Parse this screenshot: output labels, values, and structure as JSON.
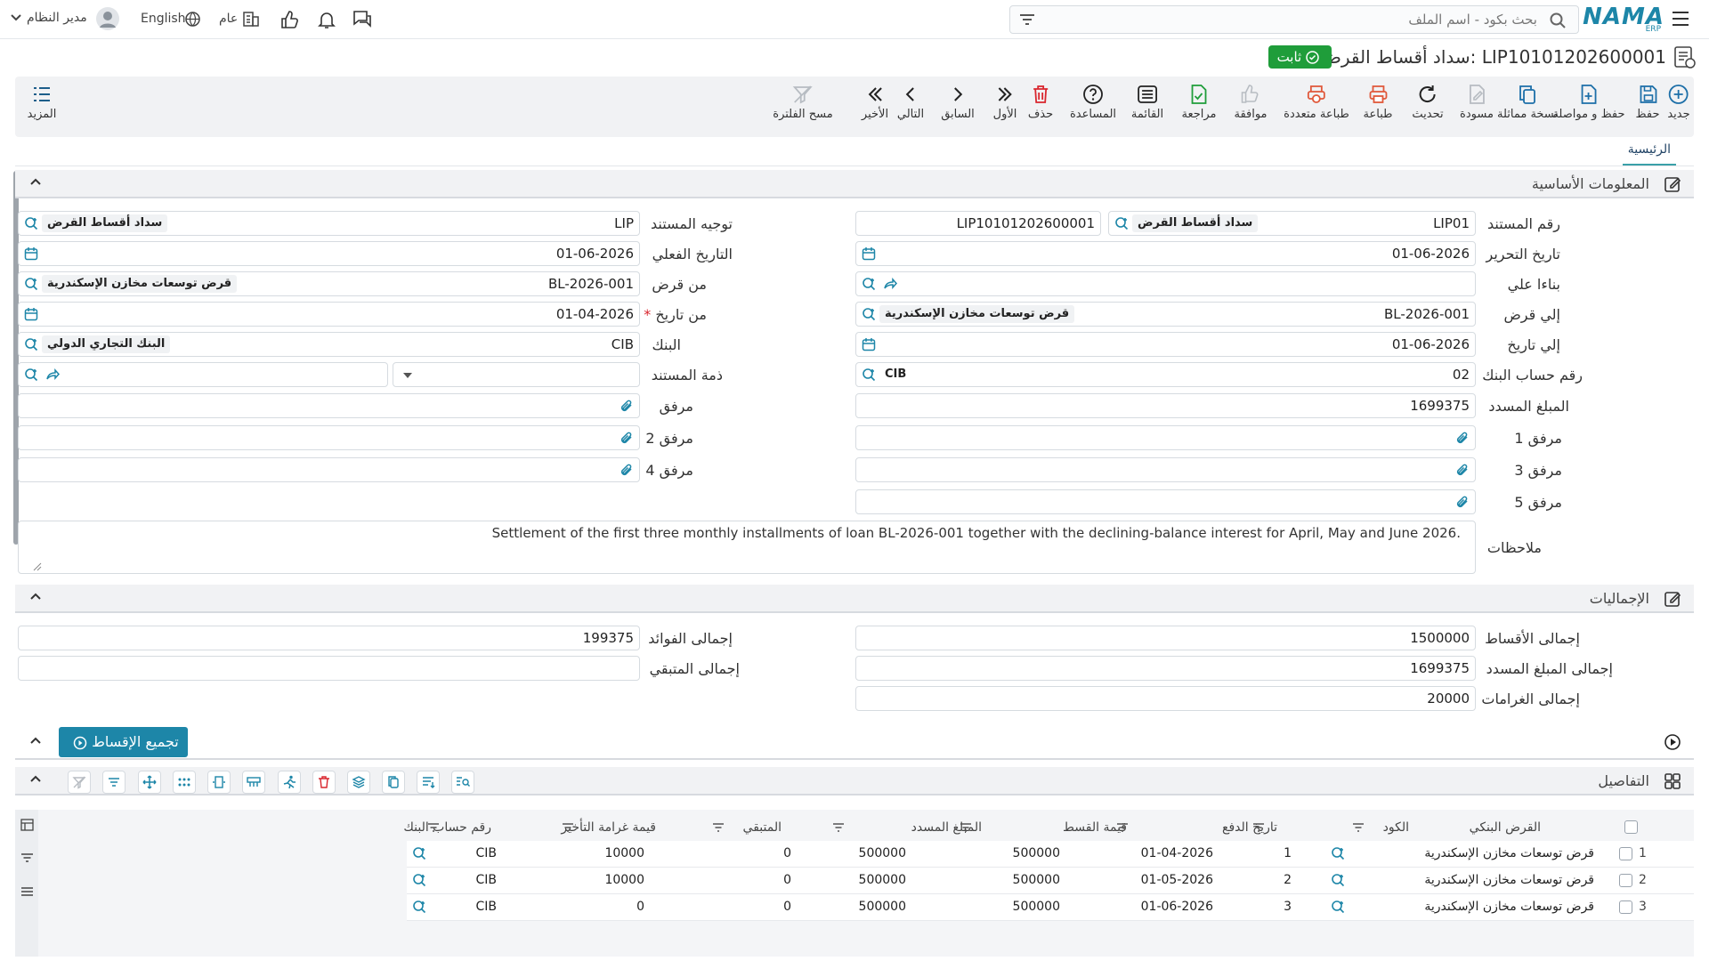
{
  "topbar": {
    "logo": "NAMA",
    "logo_sub": "ERP",
    "search_placeholder": "بحث بكود - اسم الملف",
    "user": "مدير النظام",
    "language": "English",
    "scope": "عام"
  },
  "page": {
    "title": "سداد أقساط القرض: LIP10101202600001",
    "status": "ثابت"
  },
  "toolbar": {
    "more": "المزيد",
    "buttons": [
      {
        "label": "جديد",
        "icon": "plus-circle-icon"
      },
      {
        "label": "حفظ",
        "icon": "save-icon"
      },
      {
        "label": "حفظ و مواصلة",
        "icon": "file-plus-icon"
      },
      {
        "label": "نسخة مماثلة",
        "icon": "copy-icon"
      },
      {
        "label": "مسودة",
        "icon": "draft-icon"
      },
      {
        "label": "تحديث",
        "icon": "refresh-icon"
      },
      {
        "label": "طباعة",
        "icon": "printer-icon"
      },
      {
        "label": "طباعة متعددة",
        "icon": "multi-print-icon"
      },
      {
        "label": "موافقة",
        "icon": "thumbs-up-icon"
      },
      {
        "label": "مراجعة",
        "icon": "review-icon"
      },
      {
        "label": "القائمة",
        "icon": "list-icon"
      },
      {
        "label": "المساعدة",
        "icon": "help-icon"
      },
      {
        "label": "حذف",
        "icon": "trash-icon"
      },
      {
        "label": "الأول",
        "icon": "first-icon"
      },
      {
        "label": "السابق",
        "icon": "prev-icon"
      },
      {
        "label": "التالي",
        "icon": "next-icon"
      },
      {
        "label": "الأخير",
        "icon": "last-icon"
      },
      {
        "label": "مسح الفلترة",
        "icon": "clear-filter-icon"
      }
    ]
  },
  "tabs": {
    "main": "الرئيسية"
  },
  "basic": {
    "title": "المعلومات الأساسية",
    "doc_no_label": "رقم المستند",
    "doc_no_value": "LIP01",
    "doc_no_chip": "سداد أقساط القرض",
    "doc_code": "LIP10101202600001",
    "direction_label": "توجيه المستند",
    "direction_value": "LIP",
    "direction_chip": "سداد أقساط القرض",
    "edit_date_label": "تاريخ التحرير",
    "edit_date_value": "01-06-2026",
    "actual_date_label": "التاريخ الفعلي",
    "actual_date_value": "01-06-2026",
    "based_on_label": "بناءا علي",
    "from_loan_label": "من قرض",
    "from_loan_value": "BL-2026-001",
    "from_loan_chip": "قرض توسعات مخازن الإسكندرية",
    "to_loan_label": "إلي قرض",
    "to_loan_value": "BL-2026-001",
    "to_loan_chip": "قرض توسعات مخازن الإسكندرية",
    "from_date_label": "من تاريخ",
    "from_date_value": "01-04-2026",
    "to_date_label": "إلي تاريخ",
    "to_date_value": "01-06-2026",
    "bank_label": "البنك",
    "bank_value": "CIB",
    "bank_chip": "البنك التجاري الدولي",
    "account_label": "رقم حساب البنك",
    "account_value": "02",
    "account_chip": "CIB",
    "doc_liability_label": "ذمة المستند",
    "paid_label": "المبلغ المسدد",
    "paid_value": "1699375",
    "attach_label": "مرفق",
    "attach1_label": "مرفق 1",
    "attach2_label": "مرفق 2",
    "attach3_label": "مرفق 3",
    "attach4_label": "مرفق 4",
    "attach5_label": "مرفق 5",
    "notes_label": "ملاحظات",
    "notes_value": "Settlement of the first three monthly installments of loan BL-2026-001 together with the declining-balance interest for April, May and June 2026."
  },
  "totals": {
    "title": "الإجماليات",
    "installments_label": "إجمالى الأقساط",
    "installments_value": "1500000",
    "interest_label": "إجمالى الفوائد",
    "interest_value": "199375",
    "paid_label": "إجمالى المبلغ المسدد",
    "paid_value": "1699375",
    "remaining_label": "إجمالى المتبقي",
    "remaining_value": "",
    "penalties_label": "إجمالى الغرامات",
    "penalties_value": "20000"
  },
  "group_button": "تجميع الإقساط",
  "details": {
    "title": "التفاصيل",
    "columns": [
      "القرض البنكي",
      "الكود",
      "تاريخ الدفع",
      "قيمة القسط",
      "المبلغ المسدد",
      "المتبقي",
      "قيمة غرامة التأخير",
      "رقم حساب البنك"
    ],
    "rows": [
      {
        "no": "1",
        "loan": "قرض توسعات مخازن الإسكندرية",
        "code": "1",
        "date": "01-04-2026",
        "installment": "500000",
        "paid": "500000",
        "remaining": "0",
        "penalty": "10000",
        "account": "CIB"
      },
      {
        "no": "2",
        "loan": "قرض توسعات مخازن الإسكندرية",
        "code": "2",
        "date": "01-05-2026",
        "installment": "500000",
        "paid": "500000",
        "remaining": "0",
        "penalty": "10000",
        "account": "CIB"
      },
      {
        "no": "3",
        "loan": "قرض توسعات مخازن الإسكندرية",
        "code": "3",
        "date": "01-06-2026",
        "installment": "500000",
        "paid": "500000",
        "remaining": "0",
        "penalty": "0",
        "account": "CIB"
      }
    ]
  },
  "colors": {
    "accent": "#1d86a8",
    "status": "#1f9d3a",
    "danger": "#d9262e",
    "print": "#e0583a"
  }
}
